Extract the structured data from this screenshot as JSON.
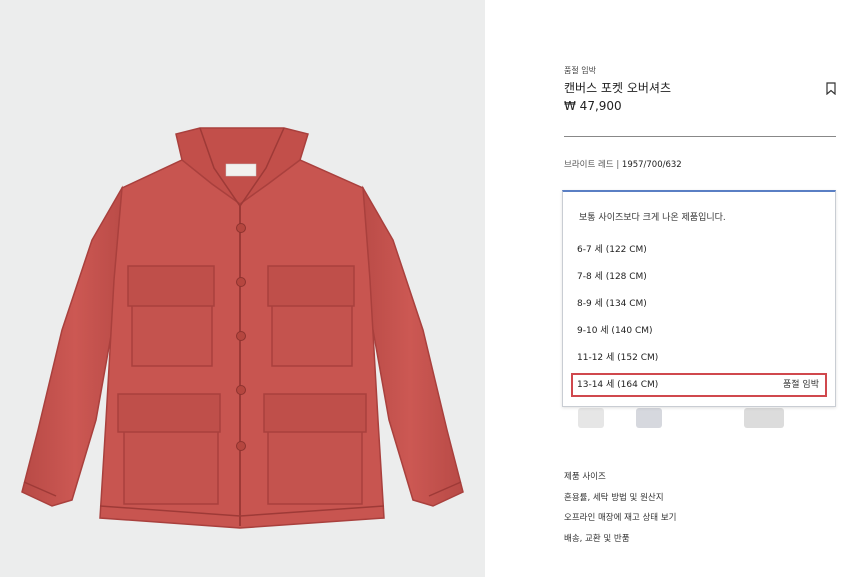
{
  "product": {
    "badge": "품절 임박",
    "title": "캔버스 포켓 오버셔츠",
    "price": "₩ 47,900",
    "color_name": "브라이트 레드",
    "color_sep": " | ",
    "color_code": "1957/700/632"
  },
  "size_dropdown": {
    "note": "보통 사이즈보다 크게 나온 제품입니다.",
    "options": [
      {
        "label": "6-7 세 (122 CM)",
        "stock": ""
      },
      {
        "label": "7-8 세 (128 CM)",
        "stock": ""
      },
      {
        "label": "8-9 세 (134 CM)",
        "stock": ""
      },
      {
        "label": "9-10 세 (140 CM)",
        "stock": ""
      },
      {
        "label": "11-12 세 (152 CM)",
        "stock": ""
      },
      {
        "label": "13-14 세 (164 CM)",
        "stock": "품절 임박"
      }
    ],
    "selected_index": 5
  },
  "links": [
    "제품 사이즈",
    "혼용률, 세탁 방법 및 원산지",
    "오프라인 매장에 재고 상태 보기",
    "배송, 교환 및 반품"
  ],
  "colors": {
    "jacket": "#c85550",
    "jacket_dark": "#a9403d",
    "background": "#eceded",
    "highlight_border": "#d0484d",
    "dropdown_accent": "#5a7fc4"
  },
  "icons": {
    "bookmark": "bookmark-icon"
  }
}
